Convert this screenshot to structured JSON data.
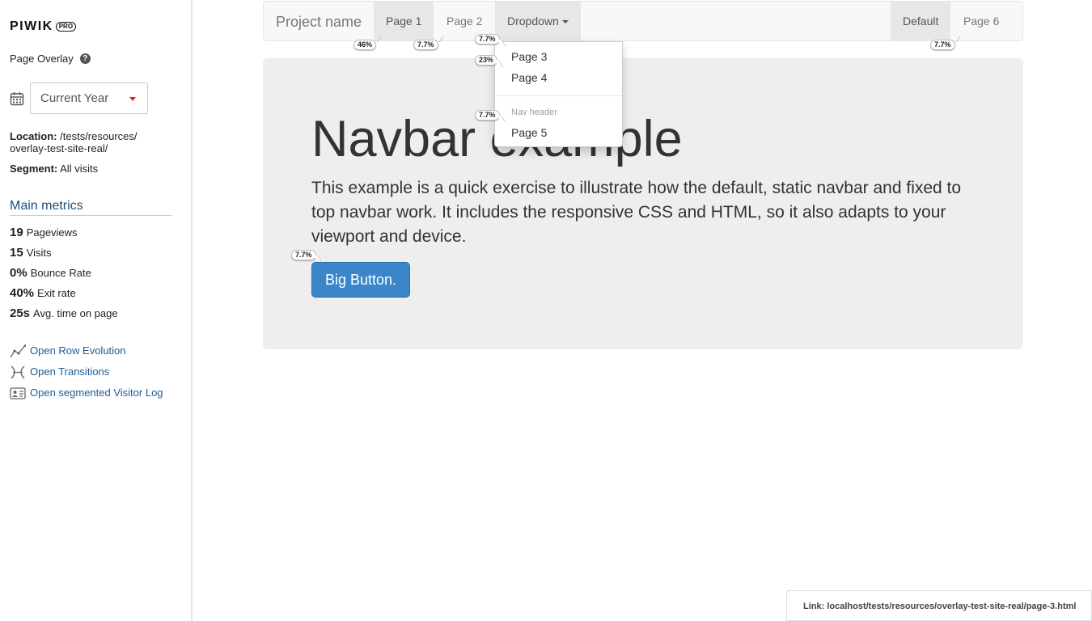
{
  "sidebar": {
    "logo": "PIWIK",
    "logo_badge": "PRO",
    "page_overlay_label": "Page Overlay",
    "help": "?",
    "period": "Current Year",
    "location_label": "Location:",
    "location_value": "/tests/resources/ overlay-test-site-real/",
    "segment_label": "Segment:",
    "segment_value": "All visits",
    "metrics_title": "Main metrics",
    "metrics": [
      {
        "value": "19",
        "label": "Pageviews"
      },
      {
        "value": "15",
        "label": "Visits"
      },
      {
        "value": "0%",
        "label": "Bounce Rate"
      },
      {
        "value": "40%",
        "label": "Exit rate"
      },
      {
        "value": "25s",
        "label": "Avg. time on page"
      }
    ],
    "actions": [
      {
        "label": "Open Row Evolution",
        "icon": "row-evolution-icon"
      },
      {
        "label": "Open Transitions",
        "icon": "transitions-icon"
      },
      {
        "label": "Open segmented Visitor Log",
        "icon": "visitor-log-icon"
      }
    ]
  },
  "navbar": {
    "brand": "Project name",
    "items": [
      "Page 1",
      "Page 2",
      "Dropdown",
      "Default",
      "Page 6"
    ]
  },
  "dropdown": {
    "items": [
      "Page 3",
      "Page 4"
    ],
    "header": "Nav header",
    "after_header": [
      "Page 5"
    ]
  },
  "jumbotron": {
    "title": "Navbar example",
    "text": "This example is a quick exercise to illustrate how the default, static navbar and fixed to top navbar work. It includes the responsive CSS and HTML, so it also adapts to your viewport and device.",
    "button": "Big Button."
  },
  "overlay_tags": {
    "page1": "46%",
    "page2": "7.7%",
    "dropdown": "7.7%",
    "page3": "23%",
    "page5": "7.7%",
    "page6": "7.7%",
    "button": "7.7%"
  },
  "status_bar": "Link: localhost/tests/resources/overlay-test-site-real/page-3.html",
  "colors": {
    "accent_link": "#1f5a94",
    "button_blue": "#3a86c9",
    "caret_red": "#d4291f"
  }
}
